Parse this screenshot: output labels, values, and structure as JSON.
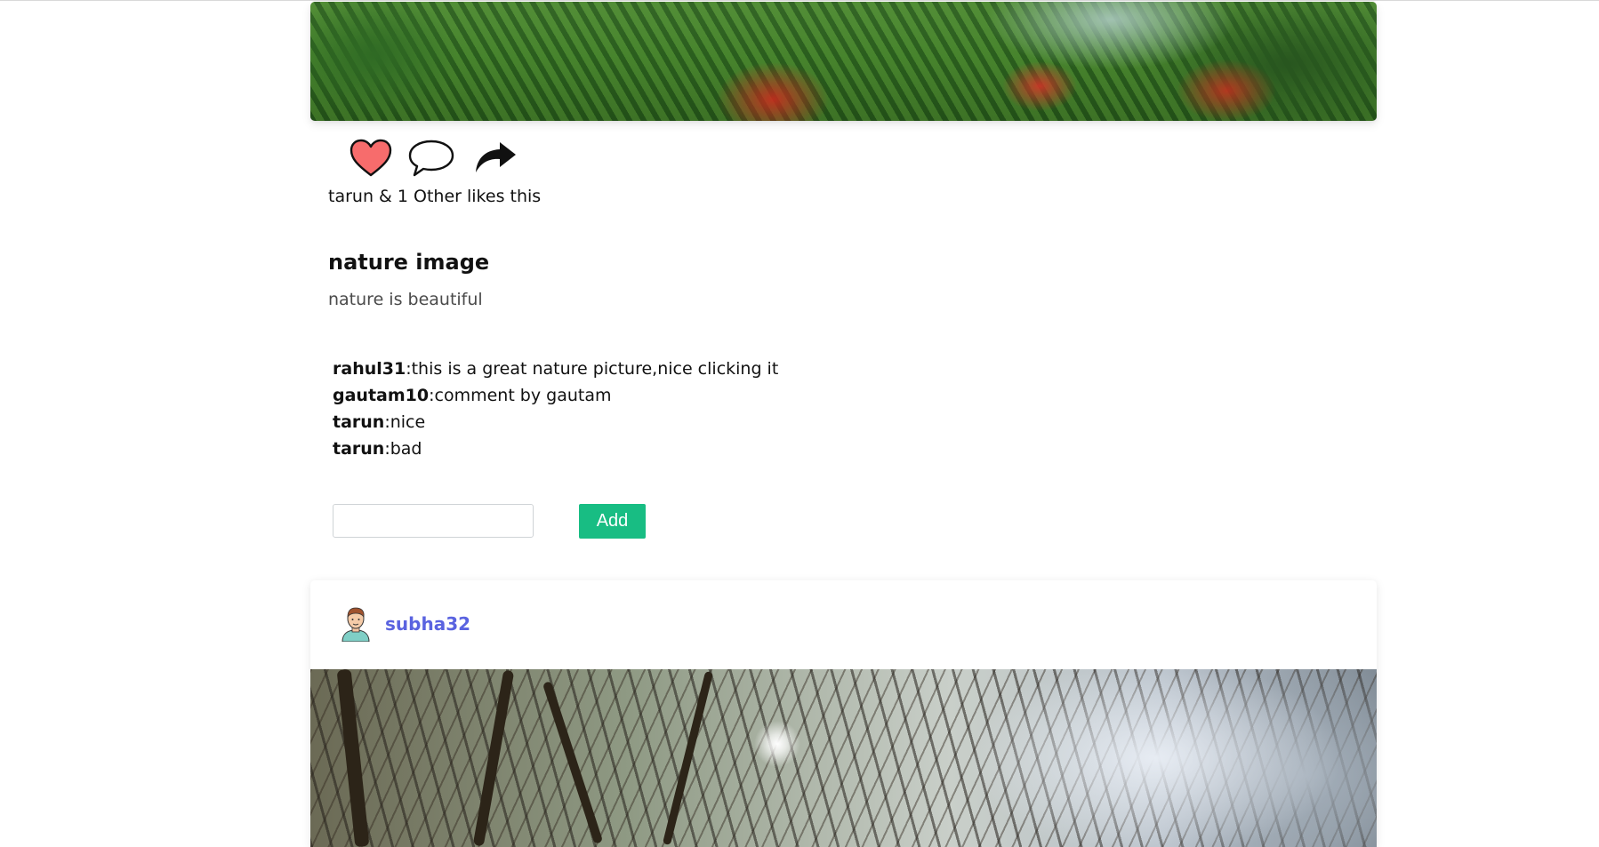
{
  "post": {
    "likes_text": "tarun & 1 Other likes this",
    "title": "nature image",
    "caption": "nature is beautiful",
    "comments": [
      {
        "user": "rahul31",
        "text": ":this is a great nature picture,nice clicking it"
      },
      {
        "user": "gautam10",
        "text": ":comment by gautam"
      },
      {
        "user": "tarun",
        "text": ":nice"
      },
      {
        "user": "tarun",
        "text": ":bad"
      }
    ],
    "comment_input": {
      "value": "",
      "placeholder": ""
    },
    "add_label": "Add",
    "icons": [
      "heart-icon",
      "speech-bubble-icon",
      "share-arrow-icon"
    ]
  },
  "next_post": {
    "username": "subha32",
    "avatar_icon": "user-avatar-icon"
  },
  "colors": {
    "heart": "#f76c6c",
    "add_button": "#18bd83",
    "username_link": "#5a63e0"
  }
}
